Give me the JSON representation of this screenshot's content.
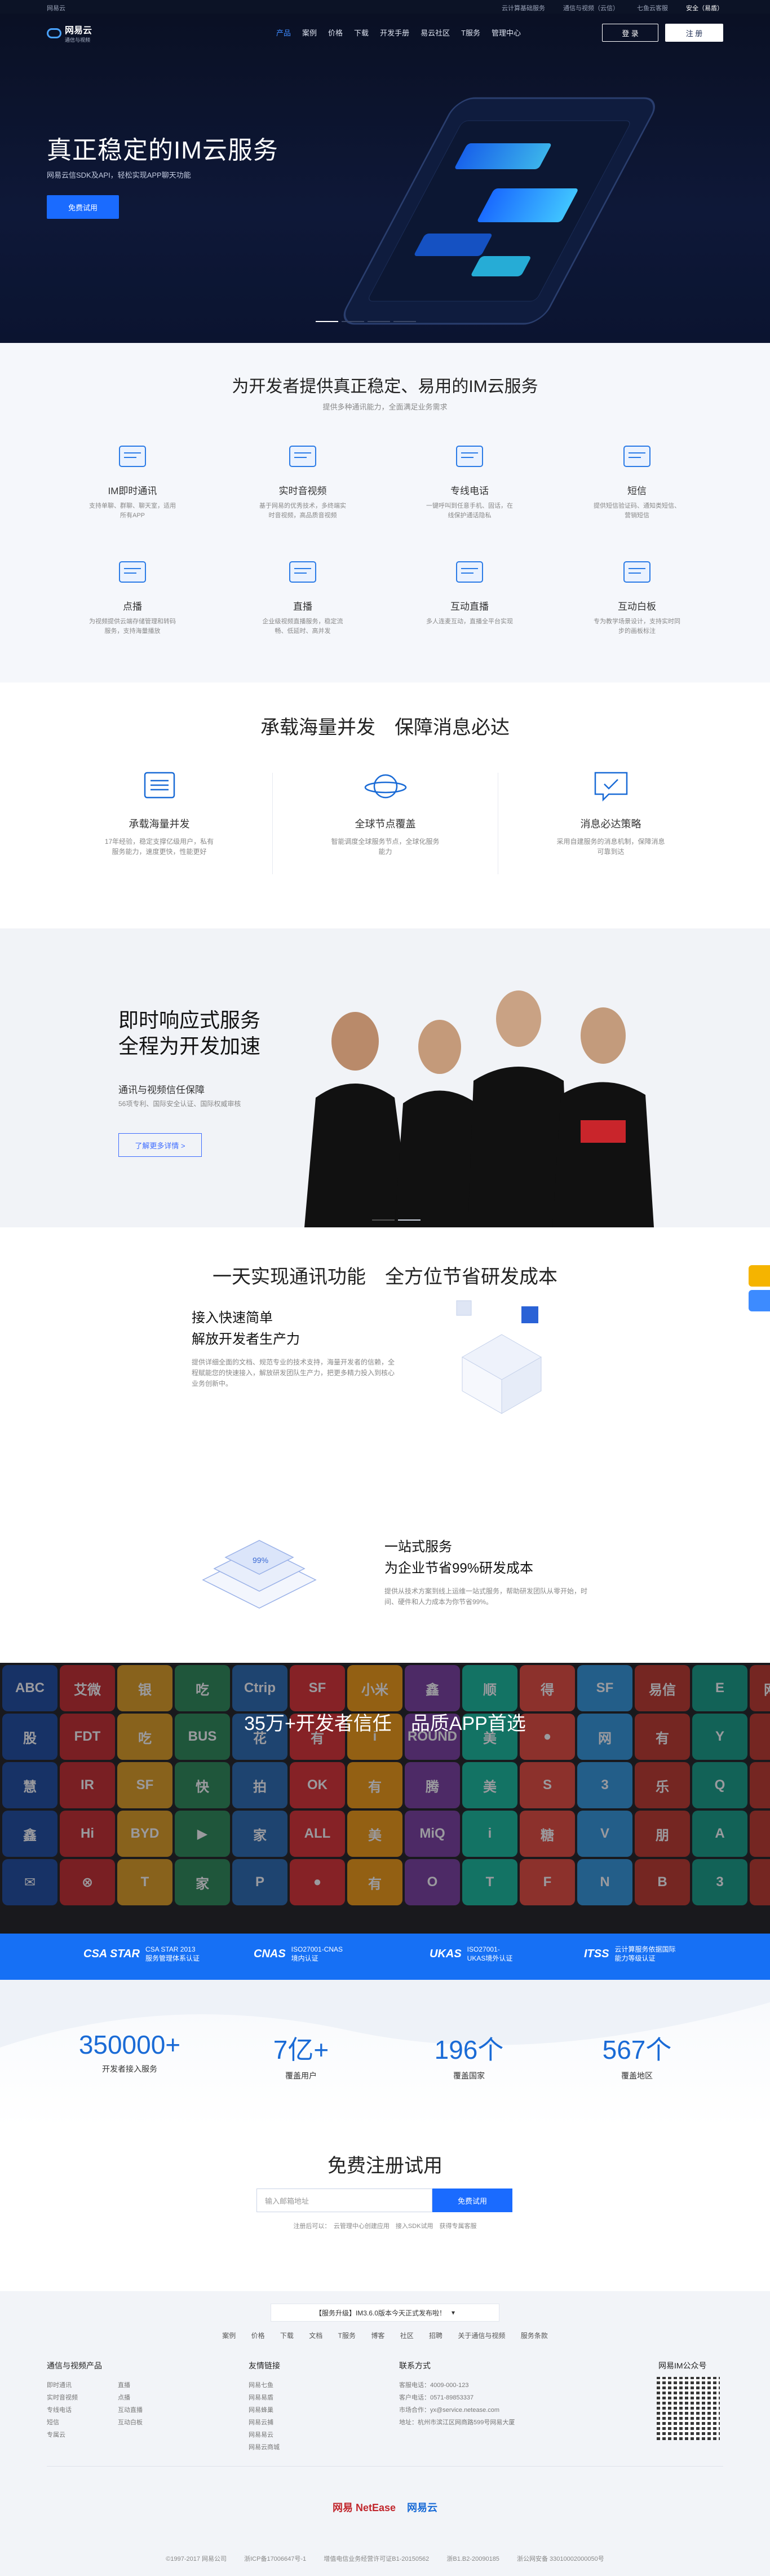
{
  "topbar": {
    "left": "网易云",
    "links": [
      "云计算基础服务",
      "通信与视频（云信）",
      "七鱼云客服",
      "安全（易盾）"
    ]
  },
  "nav": {
    "logo_main": "网易云",
    "logo_sub": "通信与视频",
    "items": [
      "产品",
      "案例",
      "价格",
      "下载",
      "开发手册",
      "易云社区",
      "T服务",
      "管理中心"
    ],
    "login": "登 录",
    "register": "注 册"
  },
  "hero": {
    "title": "真正稳定的IM云服务",
    "subtitle": "网易云信SDK及API，轻松实现APP聊天功能",
    "cta": "免费试用"
  },
  "services": {
    "title": "为开发者提供真正稳定、易用的IM云服务",
    "subtitle": "提供多种通讯能力，全面满足业务需求",
    "items": [
      {
        "name": "IM即时通讯",
        "desc": "支持单聊、群聊、聊天室，适用所有APP",
        "icon": "chat-icon"
      },
      {
        "name": "实时音视频",
        "desc": "基于网易的优秀技术，多终端实时音视频，高品质音视频",
        "icon": "av-icon"
      },
      {
        "name": "专线电话",
        "desc": "一键呼叫到任意手机、固话，在线保护通话隐私",
        "icon": "phone-icon"
      },
      {
        "name": "短信",
        "desc": "提供短信验证码、通知类短信、营销短信",
        "icon": "sms-icon"
      },
      {
        "name": "点播",
        "desc": "为视频提供云端存储管理和转码服务，支持海量播放",
        "icon": "vod-icon"
      },
      {
        "name": "直播",
        "desc": "企业级视频直播服务，稳定流畅、低延时、高并发",
        "icon": "live-icon"
      },
      {
        "name": "互动直播",
        "desc": "多人连麦互动，直播全平台实现",
        "icon": "interactive-live-icon"
      },
      {
        "name": "互动白板",
        "desc": "专为教学场景设计，支持实时同步的画板标注",
        "icon": "whiteboard-icon"
      }
    ]
  },
  "reliability": {
    "title": "承载海量并发　保障消息必达",
    "items": [
      {
        "name": "承载海量并发",
        "desc": "17年经验，稳定支撑亿级用户，私有服务能力，速度更快，性能更好",
        "icon": "server-icon"
      },
      {
        "name": "全球节点覆盖",
        "desc": "智能调度全球服务节点，全球化服务能力",
        "icon": "planet-icon"
      },
      {
        "name": "消息必达策略",
        "desc": "采用自建服务的消息机制，保障消息可靠到达",
        "icon": "message-check-icon"
      }
    ]
  },
  "team": {
    "title_line1": "即时响应式服务",
    "title_line2": "全程为开发加速",
    "point": "通讯与视频信任保障",
    "point_desc": "56项专利、国际安全认证、国际权威审核",
    "button": "了解更多详情 >"
  },
  "oneday": {
    "title": "一天实现通讯功能　全方位节省研发成本",
    "block1": {
      "title1": "接入快速简单",
      "title2": "解放开发者生产力",
      "desc": "提供详细全面的文档、规范专业的技术支持，海量开发者的信赖，全程赋能您的快速接入，解放研发团队生产力，把更多精力投入到核心业务创新中。"
    },
    "block2": {
      "title1": "一站式服务",
      "title2": "为企业节省99%研发成本",
      "desc": "提供从技术方案到线上运维一站式服务，帮助研发团队从零开始，时间、硬件和人力成本为你节省99%。"
    }
  },
  "clients": {
    "title": "35万+开发者信任　品质APP首选",
    "tiles": [
      "ABC",
      "艾微",
      "银",
      "吃",
      "Ctrip",
      "SF",
      "小米",
      "鑫",
      "顺",
      "得",
      "SF",
      "易信",
      "E",
      "网易",
      "股",
      "FDT",
      "吃",
      "BUS",
      "花",
      "有",
      "i",
      "ROUND",
      "美",
      "●",
      "网",
      "有",
      "Y",
      "爱",
      "慧",
      "IR",
      "SF",
      "快",
      "拍",
      "OK",
      "有",
      "腾",
      "美",
      "S",
      "3",
      "乐",
      "Q",
      "得",
      "鑫",
      "Hi",
      "BYD",
      "▶",
      "家",
      "ALL",
      "美",
      "MiQ",
      "i",
      "糖",
      "V",
      "朋",
      "A",
      "Y",
      "✉",
      "⊗",
      "T",
      "家",
      "P",
      "●",
      "有",
      "O",
      "T",
      "F",
      "N",
      "B",
      "3",
      "K"
    ],
    "tile_colors": [
      "#1f4ea0",
      "#c52e2e",
      "#e0a021",
      "#2e8b57",
      "#2b6cb0",
      "#d33",
      "#f39c12",
      "#7b3fa0",
      "#1abc9c",
      "#e74c3c",
      "#3498db",
      "#c0392b",
      "#16a085",
      "#c0392b"
    ]
  },
  "certs": [
    {
      "badge": "CSA STAR",
      "line1": "CSA STAR 2013",
      "line2": "服务管理体系认证"
    },
    {
      "badge": "CNAS",
      "line1": "ISO27001-CNAS",
      "line2": "境内认证"
    },
    {
      "badge": "UKAS",
      "line1": "ISO27001-",
      "line2": "UKAS境外认证"
    },
    {
      "badge": "ITSS",
      "line1": "云计算服务依据国际",
      "line2": "能力等级认证"
    }
  ],
  "stats": [
    {
      "value": "350000+",
      "label": "开发者接入服务"
    },
    {
      "value": "7亿+",
      "label": "覆盖用户"
    },
    {
      "value": "196个",
      "label": "覆盖国家"
    },
    {
      "value": "567个",
      "label": "覆盖地区"
    }
  ],
  "register": {
    "title": "免费注册试用",
    "placeholder": "输入邮箱地址",
    "button": "免费试用",
    "note": "注册后可以：　云管理中心创建应用　接入SDK试用　获得专属客服"
  },
  "footer": {
    "notice": "【服务升级】IM3.6.0版本今天正式发布啦！",
    "links": [
      "案例",
      "价格",
      "下载",
      "文档",
      "T服务",
      "博客",
      "社区",
      "招聘",
      "关于通信与视频",
      "服务条款"
    ],
    "col1": {
      "title": "通信与视频产品",
      "items": [
        "即时通讯",
        "直播",
        "实时音视频",
        "点播",
        "专线电话",
        "互动直播",
        "短信",
        "互动白板",
        "专属云"
      ]
    },
    "col2": {
      "title": "友情链接",
      "items": [
        "网易七鱼",
        "网易易盾",
        "网易蜂巢",
        "网易云捕",
        "网易易云",
        "网易云商城"
      ]
    },
    "col3": {
      "title": "联系方式",
      "items": [
        "客服电话：4009-000-123",
        "客户电话：0571-89853337",
        "市场合作：yx@service.netease.com",
        "地址：杭州市滨江区网商路599号网易大厦"
      ]
    },
    "qr_title": "网易IM公众号",
    "logo1": "网易 NetEase",
    "logo2": "网易云",
    "copyright": [
      "©1997-2017 网易公司",
      "浙ICP备17006647号-1",
      "增值电信业务经营许可证B1-20150562",
      "浙B1.B2-20090185",
      "浙公网安备 33010002000050号"
    ]
  }
}
